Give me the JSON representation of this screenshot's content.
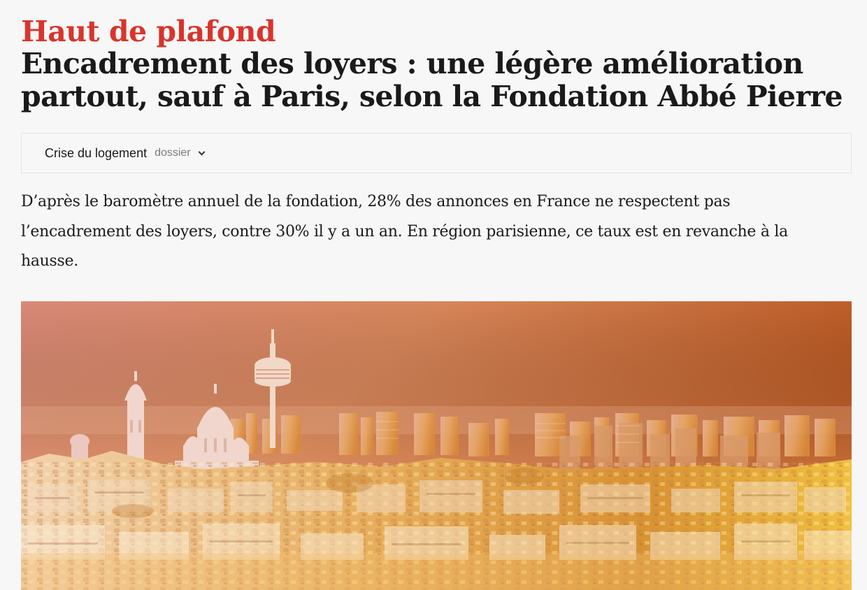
{
  "article": {
    "kicker": "Haut de plafond",
    "headline": "Encadrement des loyers : une légère amélioration partout, sauf à Paris, selon la Fondation Abbé Pierre",
    "dossier": {
      "title": "Crise du logement",
      "type": "dossier"
    },
    "lede": "D’après le baromètre annuel de la fondation, 28% des annonces en France ne respectent pas l’encadrement des loyers, contre 30% il y a un an. En région parisienne, ce taux est en revanche à la hausse."
  },
  "colors": {
    "kicker": "#d9342b",
    "text": "#1a1a1a",
    "muted": "#7a7a7a",
    "background": "#f7f7f7"
  }
}
